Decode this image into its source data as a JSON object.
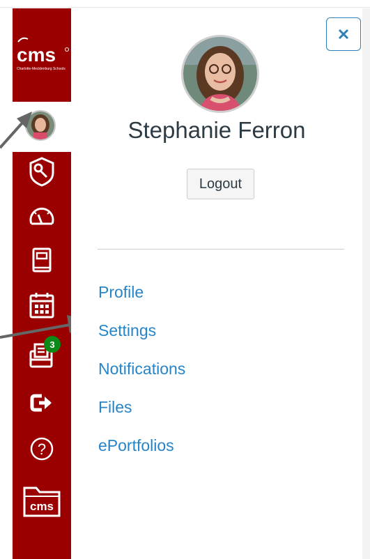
{
  "brand": {
    "logo_text": "cms",
    "logo_subtext": "Charlotte-Mecklenburg Schools",
    "primary_color": "#9a0000",
    "link_color": "#2684c8"
  },
  "global_nav": {
    "items": [
      {
        "name": "account",
        "icon": "avatar"
      },
      {
        "name": "admin",
        "icon": "shield-wrench-icon"
      },
      {
        "name": "dashboard",
        "icon": "speedometer-icon"
      },
      {
        "name": "courses",
        "icon": "book-icon"
      },
      {
        "name": "calendar",
        "icon": "calendar-icon"
      },
      {
        "name": "inbox",
        "icon": "inbox-icon",
        "badge": "3"
      },
      {
        "name": "commons",
        "icon": "arrow-out-icon"
      },
      {
        "name": "help",
        "icon": "question-circle-icon"
      },
      {
        "name": "cms-folder",
        "icon": "cms-folder-icon",
        "label": "cms"
      }
    ]
  },
  "account_tray": {
    "user_name": "Stephanie Ferron",
    "logout_label": "Logout",
    "close_icon": "close-icon",
    "links": [
      "Profile",
      "Settings",
      "Notifications",
      "Files",
      "ePortfolios"
    ]
  }
}
